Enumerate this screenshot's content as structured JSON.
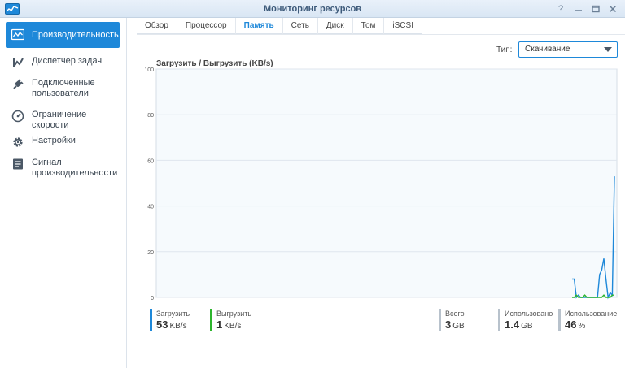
{
  "window": {
    "title": "Мониторинг ресурсов"
  },
  "window_buttons": [
    "help-icon",
    "minimize-icon",
    "maximize-icon",
    "close-icon"
  ],
  "sidebar": {
    "items": [
      {
        "label": "Производительность",
        "icon": "performance-icon",
        "active": true
      },
      {
        "label": "Диспетчер задач",
        "icon": "task-manager-icon"
      },
      {
        "label": "Подключенные пользователи",
        "icon": "plug-icon"
      },
      {
        "label": "Ограничение скорости",
        "icon": "speed-limit-icon"
      },
      {
        "label": "Настройки",
        "icon": "gear-icon"
      },
      {
        "label": "Сигнал производительности",
        "icon": "report-icon"
      }
    ]
  },
  "tabs": [
    "Обзор",
    "Процессор",
    "Память",
    "Сеть",
    "Диск",
    "Том",
    "iSCSI"
  ],
  "active_tab": "Память",
  "type_filter": {
    "label": "Тип:",
    "value": "Скачивание"
  },
  "chart_data": {
    "type": "line",
    "title": "Загрузить / Выгрузить (KB/s)",
    "ylim": [
      0,
      100
    ],
    "y_ticks": [
      0,
      20,
      40,
      60,
      80,
      100
    ],
    "grid": true,
    "series": [
      {
        "name": "Загрузить",
        "color": "#1e88d9",
        "values": [
          8,
          8,
          0,
          1,
          0,
          0,
          0,
          0,
          0,
          0,
          0,
          0,
          0,
          10,
          12,
          17,
          8,
          0,
          2,
          1,
          53
        ]
      },
      {
        "name": "Выгрузить",
        "color": "#2db52d",
        "values": [
          0,
          0,
          1,
          0,
          0,
          0,
          1,
          0,
          0,
          0,
          0,
          0,
          0,
          0,
          0,
          1,
          0,
          0,
          0,
          1,
          1
        ]
      }
    ]
  },
  "stats": {
    "download": {
      "label": "Загрузить",
      "value": "53",
      "unit": "KB/s",
      "color": "#1e88d9"
    },
    "upload": {
      "label": "Выгрузить",
      "value": "1",
      "unit": "KB/s",
      "color": "#2db52d"
    },
    "total": {
      "label": "Всего",
      "value": "3",
      "unit": "GB",
      "color": "#b8c2cc"
    },
    "used": {
      "label": "Использовано",
      "value": "1.4",
      "unit": "GB",
      "color": "#b8c2cc"
    },
    "usage": {
      "label": "Использование",
      "value": "46",
      "unit": "%",
      "color": "#b8c2cc"
    }
  }
}
